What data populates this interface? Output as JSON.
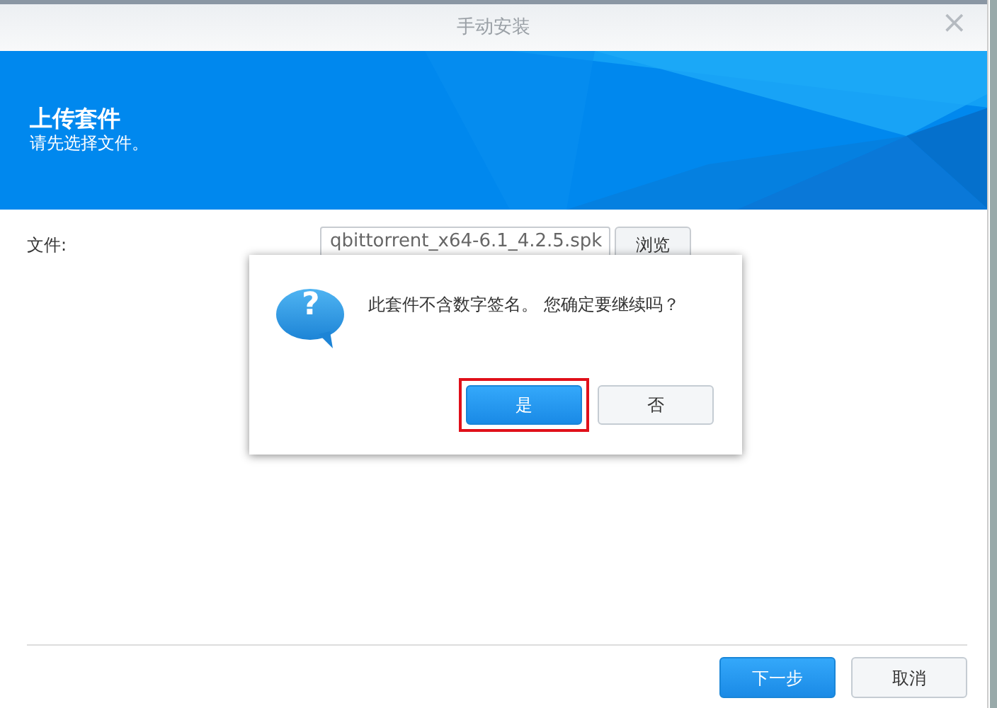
{
  "window": {
    "title": "手动安装",
    "close": "×"
  },
  "banner": {
    "title": "上传套件",
    "subtitle": "请先选择文件。"
  },
  "form": {
    "label": "文件:",
    "value": "qbittorrent_x64-6.1_4.2.5.spk",
    "browse": "浏览"
  },
  "footer": {
    "buttons": [
      {
        "label": "下一步",
        "primary": true
      },
      {
        "label": "取消",
        "primary": false
      }
    ]
  },
  "dialog": {
    "icon": "?",
    "message": "此套件不含数字签名。 您确定要继续吗？",
    "buttons": [
      {
        "label": "是",
        "primary": true,
        "highlight": true
      },
      {
        "label": "否",
        "primary": false,
        "highlight": false
      }
    ]
  }
}
